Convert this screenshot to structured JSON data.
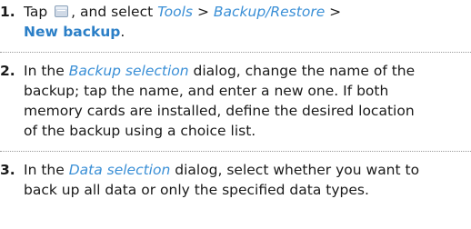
{
  "steps": [
    {
      "number": "1.",
      "lines": [
        [
          "Tap ",
          "{icon}",
          ", and select ",
          {
            "ref": "Tools"
          },
          " > ",
          {
            "ref": "Backup/Restore"
          },
          " >"
        ],
        [
          {
            "cmd": "New backup"
          },
          "."
        ]
      ]
    },
    {
      "number": "2.",
      "lines": [
        [
          "In the ",
          {
            "ref": "Backup selection"
          },
          " dialog, change the name of the"
        ],
        [
          "backup; tap the name, and enter a new one. If both"
        ],
        [
          "memory cards are installed, define the desired location"
        ],
        [
          "of the backup using a choice list."
        ]
      ]
    },
    {
      "number": "3.",
      "lines": [
        [
          "In the ",
          {
            "ref": "Data selection"
          },
          " dialog, select whether you want to"
        ],
        [
          "back up all data or only the specified data types."
        ]
      ]
    }
  ],
  "icon": "menu-icon"
}
